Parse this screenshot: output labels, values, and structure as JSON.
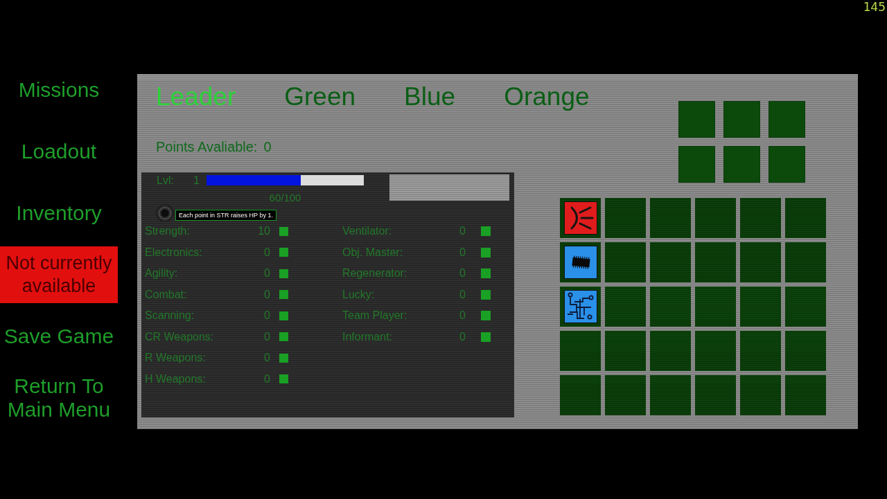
{
  "sidebar": {
    "items": [
      {
        "label": "Missions",
        "disabled": false
      },
      {
        "label": "Loadout",
        "disabled": false
      },
      {
        "label": "Inventory",
        "disabled": false
      },
      {
        "label": "Not currently available",
        "disabled": true
      },
      {
        "label": "Save Game",
        "disabled": false
      },
      {
        "label": "Return To Main Menu",
        "disabled": false
      }
    ]
  },
  "tabs": [
    {
      "label": "Leader",
      "selected": true
    },
    {
      "label": "Green",
      "selected": false
    },
    {
      "label": "Blue",
      "selected": false
    },
    {
      "label": "Orange",
      "selected": false
    }
  ],
  "points": {
    "label": "Points Avaliable:",
    "value": "0"
  },
  "equipment_slots": [
    {
      "kind": "empty"
    },
    {
      "kind": "empty"
    },
    {
      "kind": "empty"
    },
    {
      "kind": "empty"
    },
    {
      "kind": "empty"
    },
    {
      "kind": "empty"
    }
  ],
  "character": {
    "lvl_label": "Lvl:",
    "lvl": "1",
    "xp_bar": {
      "level": 0.6
    },
    "xp_text": "60/100"
  },
  "skills_left": [
    {
      "label": "Strength:",
      "value": "10"
    },
    {
      "label": "Electronics:",
      "value": "0"
    },
    {
      "label": "Agility:",
      "value": "0"
    },
    {
      "label": "Combat:",
      "value": "0"
    },
    {
      "label": "Scanning:",
      "value": "0"
    },
    {
      "label": "CR Weapons:",
      "value": "0"
    },
    {
      "label": "R Weapons:",
      "value": "0"
    },
    {
      "label": "H Weapons:",
      "value": "0"
    }
  ],
  "skills_right": [
    {
      "label": "Ventilator:",
      "value": "0"
    },
    {
      "label": "Obj. Master:",
      "value": "0"
    },
    {
      "label": "Regenerator:",
      "value": "0"
    },
    {
      "label": "Lucky:",
      "value": "0"
    },
    {
      "label": "Team Player:",
      "value": "0"
    },
    {
      "label": "Informant:",
      "value": "0"
    }
  ],
  "tooltip": {
    "text": "Each point in STR raises HP by 1."
  },
  "inventory": [
    [
      {
        "kind": "emitter",
        "color": "#e01c1c"
      },
      {
        "kind": "empty"
      },
      {
        "kind": "empty"
      },
      {
        "kind": "empty"
      },
      {
        "kind": "empty"
      },
      {
        "kind": "empty"
      }
    ],
    [
      {
        "kind": "chip",
        "color": "#2a90e8"
      },
      {
        "kind": "empty"
      },
      {
        "kind": "empty"
      },
      {
        "kind": "empty"
      },
      {
        "kind": "empty"
      },
      {
        "kind": "empty"
      }
    ],
    [
      {
        "kind": "circuit",
        "color": "#2a90e8"
      },
      {
        "kind": "empty"
      },
      {
        "kind": "empty"
      },
      {
        "kind": "empty"
      },
      {
        "kind": "empty"
      },
      {
        "kind": "empty"
      }
    ],
    [
      {
        "kind": "empty"
      },
      {
        "kind": "empty"
      },
      {
        "kind": "empty"
      },
      {
        "kind": "empty"
      },
      {
        "kind": "empty"
      },
      {
        "kind": "empty"
      }
    ],
    [
      {
        "kind": "empty"
      },
      {
        "kind": "empty"
      },
      {
        "kind": "empty"
      },
      {
        "kind": "empty"
      },
      {
        "kind": "empty"
      },
      {
        "kind": "empty"
      }
    ]
  ],
  "fps": "145"
}
